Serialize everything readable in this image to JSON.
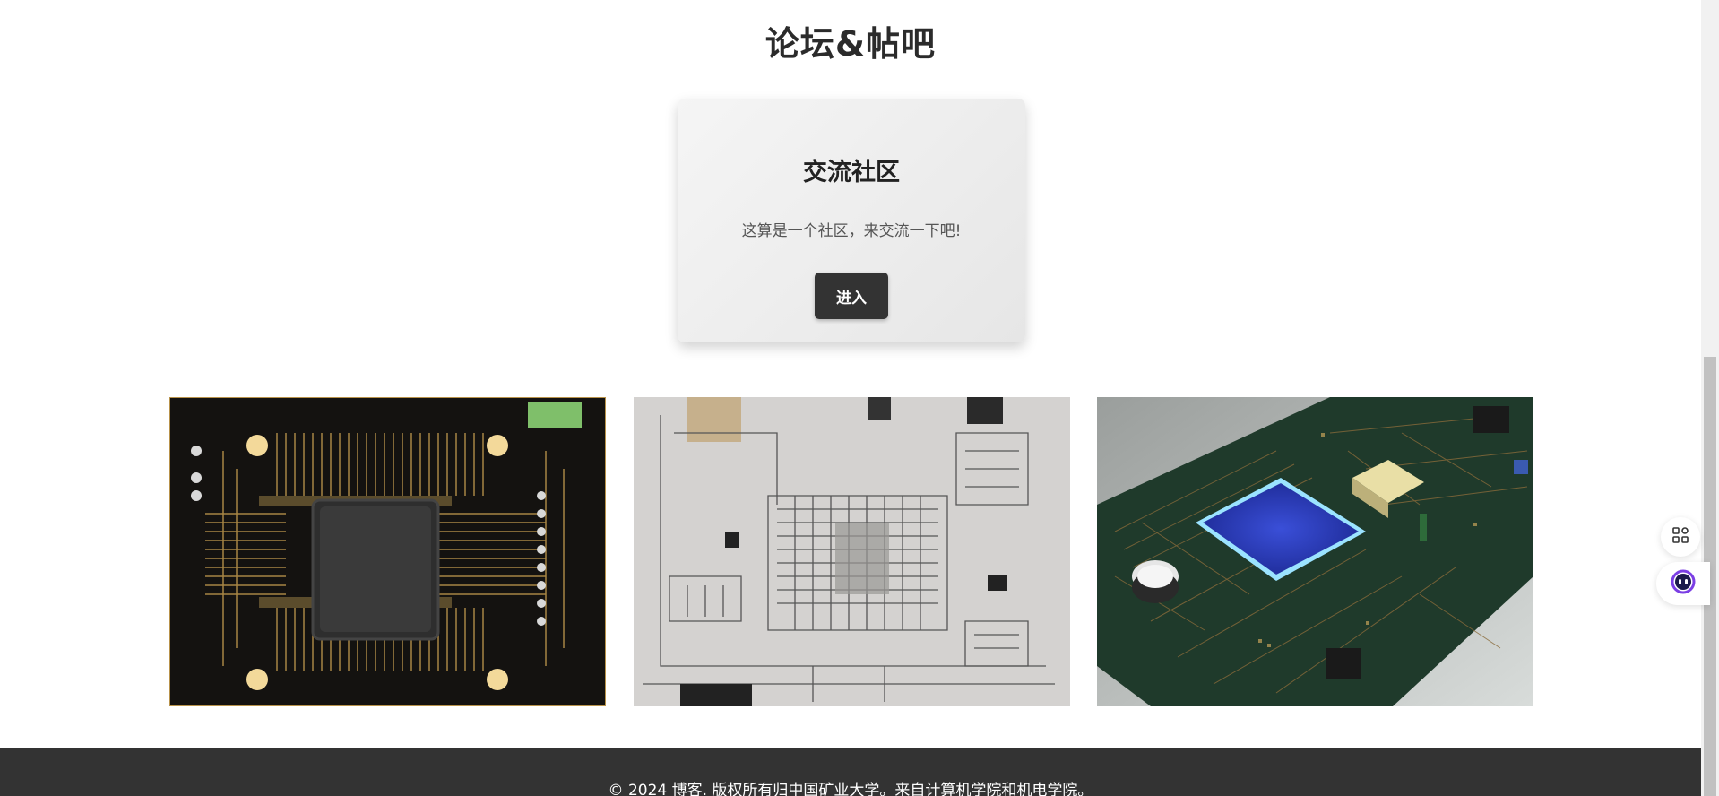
{
  "section": {
    "title": "论坛&帖吧"
  },
  "card": {
    "title": "交流社区",
    "description": "这算是一个社区，来交流一下吧!",
    "button_label": "进入"
  },
  "gallery": {
    "images": [
      {
        "icon": "circuit-board-chip-dark-image"
      },
      {
        "icon": "circuit-schematic-sketch-image"
      },
      {
        "icon": "pcb-blue-chip-image"
      }
    ]
  },
  "footer": {
    "copyright": "© 2024 博客. 版权所有归中国矿业大学。来自计算机学院和机电学院。"
  },
  "floating": {
    "apps_icon": "grid-apps-icon",
    "assistant_icon": "assistant-face-icon"
  },
  "colors": {
    "footer_bg": "#333333",
    "button_bg": "#333333",
    "assistant_accent": "#7b3fe4"
  }
}
